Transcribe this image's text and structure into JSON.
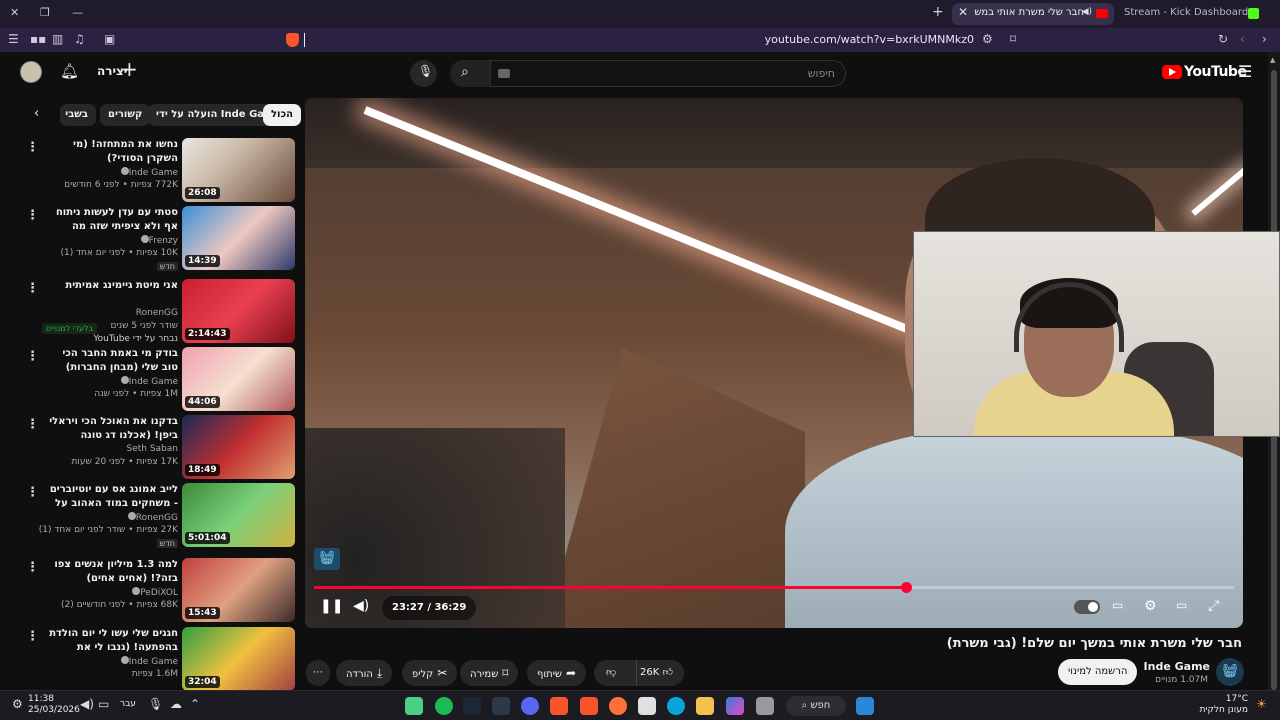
{
  "browser": {
    "active_tab": {
      "title": "חבר שלי משרת אותי במשך יום שלם"
    },
    "inactive_tab": {
      "title": "Stream - Kick Dashboard"
    },
    "url": "youtube.com/watch?v=bxrkUMNMkz0"
  },
  "header": {
    "create_label": "יצירה",
    "search_placeholder": "חיפוש",
    "logo_text": "YouTube"
  },
  "chips": [
    "הכול",
    "הועלה על ידי Inde Game",
    "קשורים",
    "בשבי"
  ],
  "recommendations": [
    {
      "title": "נחשו את המתחזה! (מי השקרן הסודי?)",
      "channel": "Inde Game",
      "meta": "772K צפיות • לפני 6 חודשים",
      "duration": "26:08"
    },
    {
      "title": "סטתי עם עדן לעשות ניתוח אף ולא ציפיתי שזה מה שיקרה...",
      "channel": "Frenzy",
      "meta": "10K צפיות • לפני יום אחד (1)",
      "duration": "14:39",
      "badge": "חדש"
    },
    {
      "title": "אני מיטת גיימינג אמיתית",
      "channel": "RonenGG",
      "meta": "שודר לפני 5 שנים",
      "duration": "2:14:43",
      "subline": "נבחר על ידי YouTube",
      "members": "בלעדי למנויים"
    },
    {
      "title": "בודק מי באמת החבר הכי טוב שלי (מבחן החברות)",
      "channel": "Inde Game",
      "meta": "1M צפיות • לפני שנה",
      "duration": "44:06"
    },
    {
      "title": "בדקנו את האוכל הכי ויראלי ביפן! (אכלנו דג טונה שלם..)",
      "channel": "Seth Saban",
      "meta": "17K צפיות • לפני 20 שעות",
      "duration": "18:49"
    },
    {
      "title": "לייב אמונג אס עם יוטיוברים - משחקים במוד האהוב על ג'ושי",
      "channel": "RonenGG",
      "meta": "27K צפיות • שודר לפני יום אחד (1)",
      "duration": "5:01:04",
      "badge": "חדש"
    },
    {
      "title": "למה 1.3 מיליון אנשים צפו בזה?! (אחים אחים)",
      "channel": "PeDiXOL",
      "meta": "68K צפיות • לפני חודשיים (2)",
      "duration": "15:43"
    },
    {
      "title": "חגגים שלי עשו לי יום הולדת בהפתעה! (גנבו לי את האשראי..)",
      "channel": "Inde Game",
      "meta": "1.6M צפיות",
      "duration": "32:04"
    }
  ],
  "player": {
    "time": "23:27 / 36:29",
    "progress": 0.643
  },
  "video": {
    "title": "חבר שלי משרת אותי במשך יום שלם! (גבי משרת)",
    "channel": "Inde Game",
    "subscribers": "1.07M מנויים",
    "subscribe_label": "הרשמה למינוי",
    "likes": "26K",
    "share_label": "שיתוף",
    "save_label": "שמירה",
    "clip_label": "קליפ",
    "download_label": "הורדה"
  },
  "taskbar": {
    "time": "11:38",
    "date": "25/03/2026",
    "lang": "עבר",
    "search_label": "חפש",
    "temp": "17°C",
    "weather": "מעונן חלקית"
  },
  "colors": {
    "accent": "#ff0033",
    "brand": "#ff0000",
    "kick": "#53fc18"
  }
}
